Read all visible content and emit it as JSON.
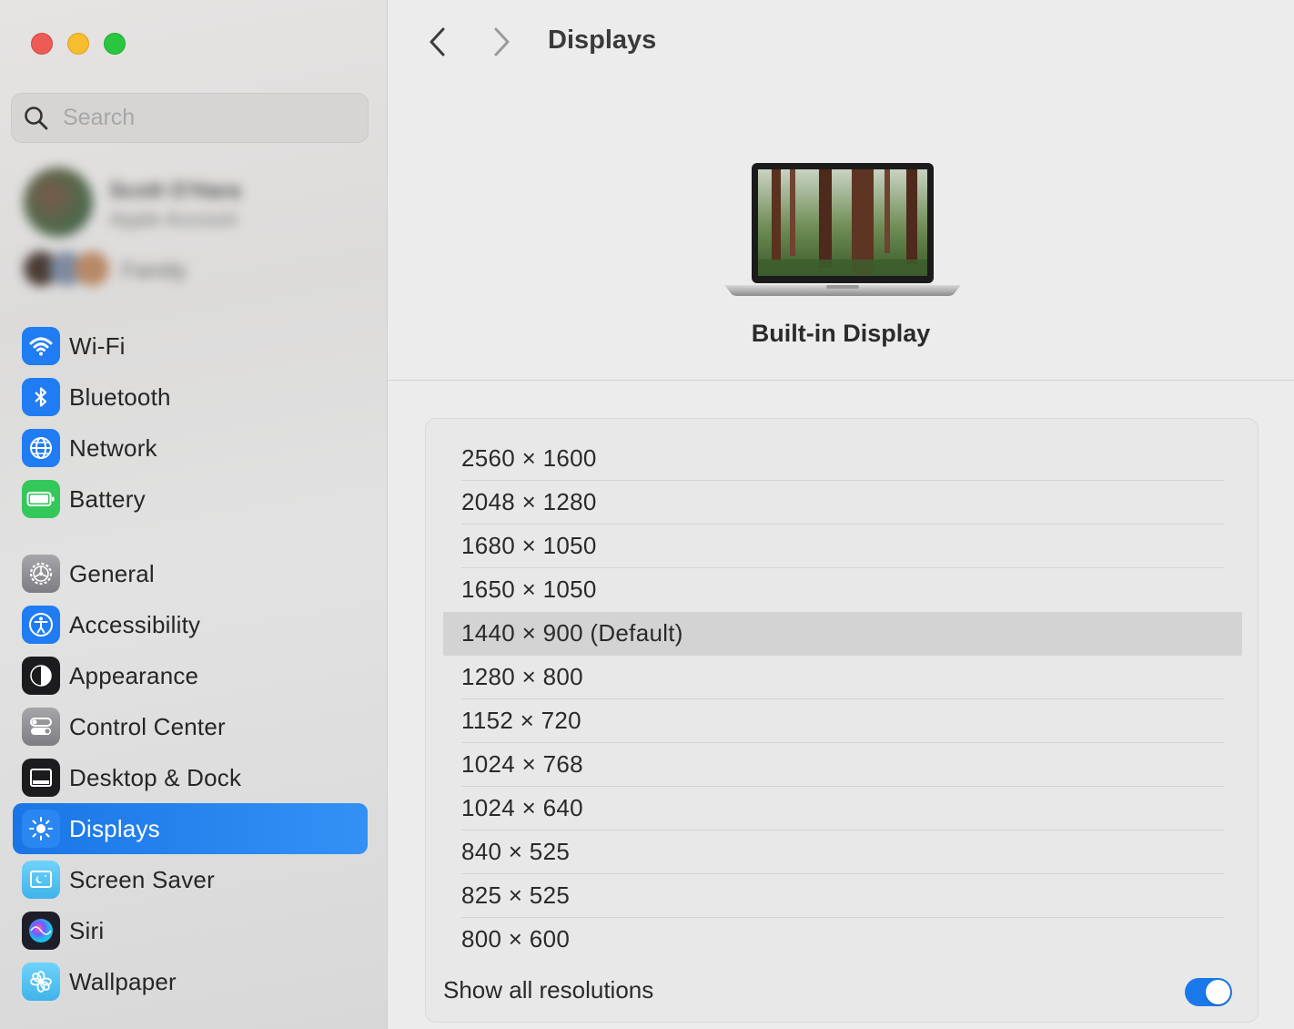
{
  "window": {
    "title": "Displays"
  },
  "search": {
    "placeholder": "Search"
  },
  "account": {
    "name": "Scott O'Hara",
    "subtitle": "Apple Account",
    "family_label": "Family"
  },
  "sidebar": {
    "items": [
      {
        "label": "Wi-Fi",
        "icon": "wifi-icon",
        "color": "#1f7cf2"
      },
      {
        "label": "Bluetooth",
        "icon": "bluetooth-icon",
        "color": "#1f7cf2"
      },
      {
        "label": "Network",
        "icon": "globe-icon",
        "color": "#1f7cf2"
      },
      {
        "label": "Battery",
        "icon": "battery-icon",
        "color": "#34c759"
      },
      {
        "label": "General",
        "icon": "gear-icon",
        "color": "#8e8e93"
      },
      {
        "label": "Accessibility",
        "icon": "accessibility-icon",
        "color": "#1f7cf2"
      },
      {
        "label": "Appearance",
        "icon": "appearance-icon",
        "color": "#1c1c1e"
      },
      {
        "label": "Control Center",
        "icon": "control-center-icon",
        "color": "#8e8e93"
      },
      {
        "label": "Desktop & Dock",
        "icon": "desktop-dock-icon",
        "color": "#1c1c1e"
      },
      {
        "label": "Displays",
        "icon": "sun-icon",
        "color": "#1f7cf2",
        "selected": true
      },
      {
        "label": "Screen Saver",
        "icon": "screen-saver-icon",
        "color": "#5ac8fa"
      },
      {
        "label": "Siri",
        "icon": "siri-icon",
        "color": "#2b2b3a"
      },
      {
        "label": "Wallpaper",
        "icon": "wallpaper-icon",
        "color": "#5ac8fa"
      }
    ]
  },
  "display": {
    "name": "Built-in Display"
  },
  "resolutions": {
    "items": [
      "2560 × 1600",
      "2048 × 1280",
      "1680 × 1050",
      "1650 × 1050",
      "1440 × 900 (Default)",
      "1280 × 800",
      "1152 × 720",
      "1024 × 768",
      "1024 × 640",
      "840 × 525",
      "825 × 525",
      "800 × 600"
    ],
    "selected_index": 4,
    "show_all_label": "Show all resolutions",
    "show_all_enabled": true
  },
  "colors": {
    "accent": "#1a79ea",
    "selection_row": "#d3d3d3"
  }
}
